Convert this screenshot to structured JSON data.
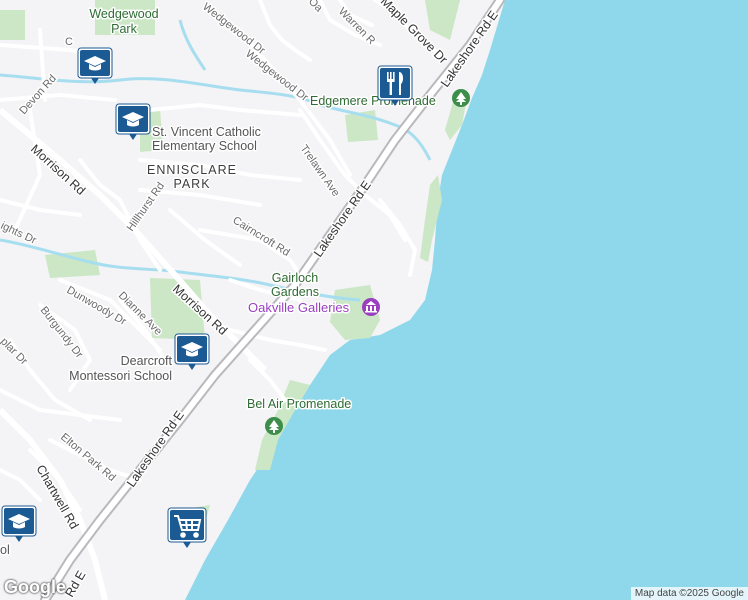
{
  "map": {
    "colors": {
      "water": "#8fd8ec",
      "land": "#f4f3f5",
      "park": "#cbe7c6",
      "road": "#ffffff",
      "major_road": "#b9b9bd",
      "creek": "#a6def0",
      "pin_bg": "#1b5a92"
    },
    "labels": {
      "wedgewood_park": [
        "Wedgewood",
        "Park"
      ],
      "wedgewood_dr_1": "Wedgewood Dr",
      "wedgewood_dr_2": "Wedgewood Dr",
      "warren_rd": "Warren R",
      "maple_grove_dr": "Maple Grove Dr",
      "lakeshore_top": "Lakeshore Rd E",
      "lakeshore_mid": "Lakeshore Rd E",
      "lakeshore_bottom": "Lakeshore Rd E",
      "lakeshore_corner": "Rd E",
      "edgemere": "Edgemere Promenade",
      "devon_rd": "Devon Rd",
      "morrison_rd_1": "Morrison Rd",
      "morrison_rd_2": "Morrison Rd",
      "st_vincent": [
        "St. Vincent Catholic",
        "Elementary School"
      ],
      "ennisclare": [
        "ENNISCLARE",
        "PARK"
      ],
      "trelawn_ave": "Trelawn Ave",
      "hillhurst_rd": "Hillhurst Rd",
      "heights_dr": "ights Dr",
      "cairncroft_rd": "Cairncroft Rd",
      "gairloch": [
        "Gairloch",
        "Gardens"
      ],
      "oakville_galleries": "Oakville Galleries",
      "dunwoody_dr": "Dunwoody Dr",
      "dianne_ave": "Dianne Ave",
      "burgundy_dr": "Burgundy Dr",
      "poplar_dr": "plar Dr",
      "dearcroft": [
        "Dearcroft",
        "Montessori School"
      ],
      "bel_air": "Bel Air Promenade",
      "elton_park_rd": "Elton Park Rd",
      "chartwell_rd": "Chartwell Rd",
      "corner_ol": "ol",
      "corner_c": "C",
      "corner_oa": "Oa"
    },
    "pins": {
      "school": "school-icon",
      "restaurant": "restaurant-icon",
      "shopping": "shopping-cart-icon",
      "park": "tree-icon",
      "museum": "museum-icon"
    }
  },
  "attribution": "Map data ©2025 Google",
  "logo": "Google"
}
